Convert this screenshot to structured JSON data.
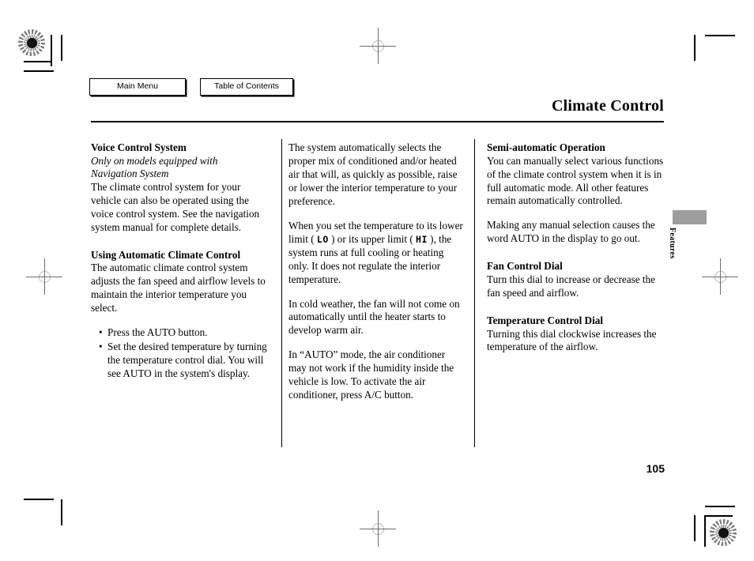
{
  "nav": {
    "main_menu": "Main Menu",
    "table_of_contents": "Table of Contents"
  },
  "header": {
    "title": "Climate Control"
  },
  "side_tab": {
    "label": "Features"
  },
  "page": {
    "number": "105"
  },
  "columns": {
    "left": {
      "heading1": "Voice Control System",
      "subnote_line1": "Only on models equipped with",
      "subnote_line2": "Navigation System",
      "para1": "The climate control system for your vehicle can also be operated using the voice control system. See the navigation system manual for complete details.",
      "heading2": "Using Automatic Climate Control",
      "para2": "The automatic climate control system adjusts the fan speed and airflow levels to maintain the interior temperature you select.",
      "bullets": [
        "Press the AUTO button.",
        "Set the desired temperature by turning the temperature control dial. You will see AUTO in the system's display."
      ]
    },
    "middle": {
      "para1": "The system automatically selects the proper mix of conditioned and/or heated air that will, as quickly as possible, raise or lower the interior temperature to your preference.",
      "para2_part1": "When you set the temperature to its lower limit ( ",
      "para2_icon_low": "LO",
      "para2_part2": " ) or its upper limit ( ",
      "para2_icon_high": "HI",
      "para2_part3": " ), the system runs at full cooling or heating only. It does not regulate the interior temperature.",
      "para3": "In cold weather, the fan will not come on automatically until the heater starts to develop warm air.",
      "para4": "In “AUTO” mode, the air conditioner may not work if the humidity inside the vehicle is low. To activate the air conditioner, press A/C button."
    },
    "right": {
      "heading1": "Semi-automatic Operation",
      "para1": "You can manually select various functions of the climate control system when it is in full automatic mode. All other features remain automatically controlled.",
      "para2": "Making any manual selection causes the word AUTO in the display to go out.",
      "heading2": "Fan Control Dial",
      "para3": "Turn this dial to increase or decrease the fan speed and airflow.",
      "heading3": "Temperature Control Dial",
      "para4": "Turning this dial clockwise increases the temperature of the airflow."
    }
  }
}
